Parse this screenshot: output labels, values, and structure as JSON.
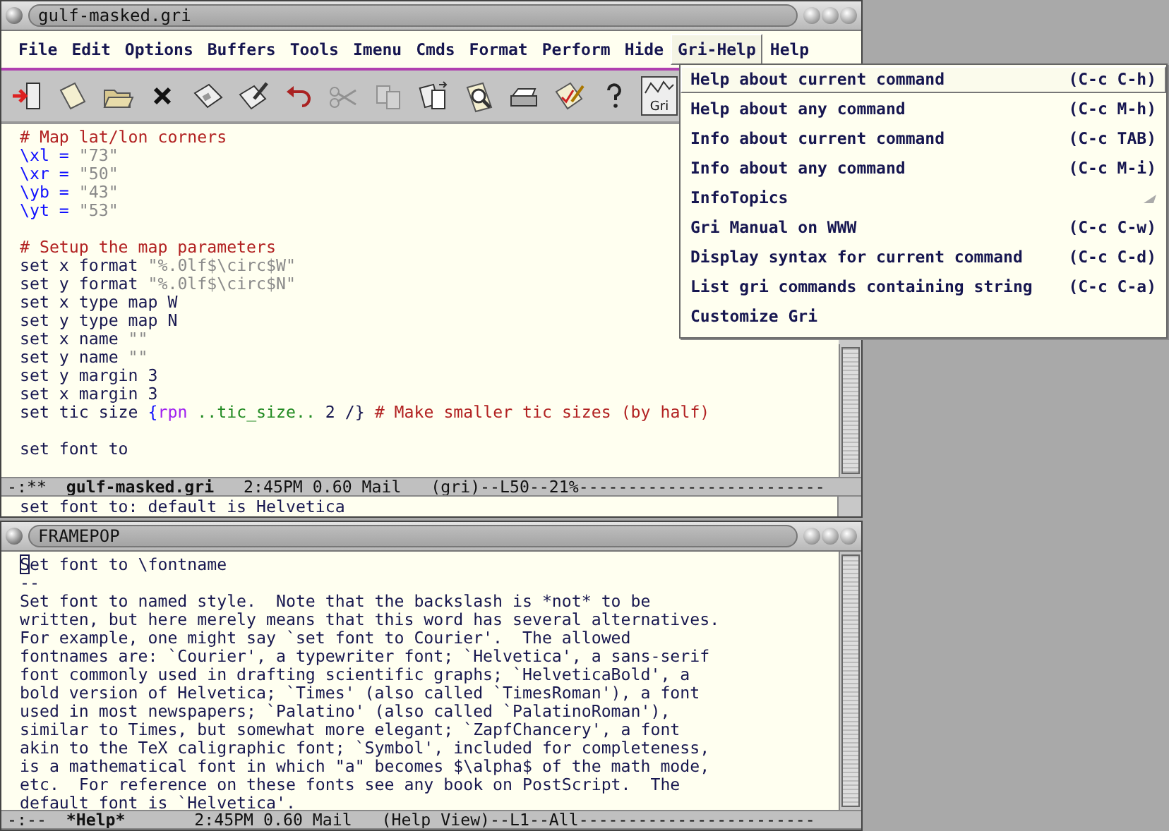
{
  "windows": [
    {
      "title": "gulf-masked.gri",
      "menubar": [
        {
          "label": "File",
          "selected": false
        },
        {
          "label": "Edit",
          "selected": false
        },
        {
          "label": "Options",
          "selected": false
        },
        {
          "label": "Buffers",
          "selected": false
        },
        {
          "label": "Tools",
          "selected": false
        },
        {
          "label": "Imenu",
          "selected": false
        },
        {
          "label": "Cmds",
          "selected": false
        },
        {
          "label": "Format",
          "selected": false
        },
        {
          "label": "Perform",
          "selected": false
        },
        {
          "label": "Hide",
          "selected": false
        },
        {
          "label": "Gri-Help",
          "selected": true
        },
        {
          "label": "Help",
          "selected": false
        }
      ],
      "toolbar": [
        {
          "kind": "exit",
          "disabled": false
        },
        {
          "kind": "new",
          "disabled": false
        },
        {
          "kind": "open",
          "disabled": false
        },
        {
          "kind": "close",
          "disabled": false
        },
        {
          "kind": "save",
          "disabled": false
        },
        {
          "kind": "saveas",
          "disabled": false
        },
        {
          "kind": "undo",
          "disabled": false
        },
        {
          "kind": "cut",
          "disabled": true
        },
        {
          "kind": "copy",
          "disabled": true
        },
        {
          "kind": "paste",
          "disabled": false
        },
        {
          "kind": "search",
          "disabled": false
        },
        {
          "kind": "print",
          "disabled": false
        },
        {
          "kind": "spell",
          "disabled": false
        },
        {
          "kind": "help",
          "disabled": false
        },
        {
          "kind": "gri",
          "label": "Gri",
          "disabled": false
        }
      ],
      "lines": [
        {
          "kind": "code",
          "segments": [
            {
              "text": "# Map lat/lon corners",
              "kind": "comment"
            }
          ]
        },
        {
          "kind": "code",
          "segments": [
            {
              "text": "\\xl = ",
              "kind": "variable"
            },
            {
              "text": "\"73\"",
              "kind": "string"
            }
          ]
        },
        {
          "kind": "code",
          "segments": [
            {
              "text": "\\xr = ",
              "kind": "variable"
            },
            {
              "text": "\"50\"",
              "kind": "string"
            }
          ]
        },
        {
          "kind": "code",
          "segments": [
            {
              "text": "\\yb = ",
              "kind": "variable"
            },
            {
              "text": "\"43\"",
              "kind": "string"
            }
          ]
        },
        {
          "kind": "code",
          "segments": [
            {
              "text": "\\yt = ",
              "kind": "variable"
            },
            {
              "text": "\"53\"",
              "kind": "string"
            }
          ]
        },
        {
          "kind": "blank"
        },
        {
          "kind": "code",
          "segments": [
            {
              "text": "# Setup the map parameters",
              "kind": "comment"
            }
          ]
        },
        {
          "kind": "code",
          "segments": [
            {
              "text": "set x format ",
              "kind": "plain"
            },
            {
              "text": "\"%.0lf$\\circ$W\"",
              "kind": "string"
            }
          ]
        },
        {
          "kind": "code",
          "segments": [
            {
              "text": "set y format ",
              "kind": "plain"
            },
            {
              "text": "\"%.0lf$\\circ$N\"",
              "kind": "string"
            }
          ]
        },
        {
          "kind": "code",
          "segments": [
            {
              "text": "set x type map W",
              "kind": "plain"
            }
          ]
        },
        {
          "kind": "code",
          "segments": [
            {
              "text": "set y type map N",
              "kind": "plain"
            }
          ]
        },
        {
          "kind": "code",
          "segments": [
            {
              "text": "set x name ",
              "kind": "plain"
            },
            {
              "text": "\"\"",
              "kind": "string"
            }
          ]
        },
        {
          "kind": "code",
          "segments": [
            {
              "text": "set y name ",
              "kind": "plain"
            },
            {
              "text": "\"\"",
              "kind": "string"
            }
          ]
        },
        {
          "kind": "code",
          "segments": [
            {
              "text": "set y margin 3",
              "kind": "plain"
            }
          ]
        },
        {
          "kind": "code",
          "segments": [
            {
              "text": "set x margin 3",
              "kind": "plain"
            }
          ]
        },
        {
          "kind": "code",
          "segments": [
            {
              "text": "set tic size ",
              "kind": "plain"
            },
            {
              "text": "{",
              "kind": "variable"
            },
            {
              "text": "rpn",
              "kind": "keyword"
            },
            {
              "text": " ..tic_size..",
              "kind": "constant"
            },
            {
              "text": " 2 /} ",
              "kind": "plain"
            },
            {
              "text": "# Make smaller tic sizes (by half)",
              "kind": "comment"
            }
          ]
        },
        {
          "kind": "blank"
        },
        {
          "kind": "code",
          "segments": [
            {
              "text": "set font to",
              "kind": "plain"
            }
          ]
        }
      ],
      "mode_line": {
        "flags": "-:**",
        "buffer": "gulf-masked.gri",
        "info": "2:45PM 0.60 Mail   (gri)--L50--21%-------------------------"
      },
      "echo": "set font to: default is Helvetica"
    },
    {
      "title": "FRAMEPOP",
      "lines": [
        {
          "kind": "code",
          "segments": [
            {
              "text": "S",
              "kind": "cursor"
            },
            {
              "text": "et font to \\fontname",
              "kind": "plain"
            }
          ]
        },
        {
          "kind": "code",
          "segments": [
            {
              "text": "--",
              "kind": "plain"
            }
          ]
        },
        {
          "kind": "code",
          "segments": [
            {
              "text": "Set font to named style.  Note that the backslash is *not* to be",
              "kind": "plain"
            }
          ]
        },
        {
          "kind": "code",
          "segments": [
            {
              "text": "written, but here merely means that this word has several alternatives.",
              "kind": "plain"
            }
          ]
        },
        {
          "kind": "code",
          "segments": [
            {
              "text": "For example, one might say `set font to Courier'.  The allowed",
              "kind": "plain"
            }
          ]
        },
        {
          "kind": "code",
          "segments": [
            {
              "text": "fontnames are: `Courier', a typewriter font; `Helvetica', a sans-serif",
              "kind": "plain"
            }
          ]
        },
        {
          "kind": "code",
          "segments": [
            {
              "text": "font commonly used in drafting scientific graphs; `HelveticaBold', a",
              "kind": "plain"
            }
          ]
        },
        {
          "kind": "code",
          "segments": [
            {
              "text": "bold version of Helvetica; `Times' (also called `TimesRoman'), a font",
              "kind": "plain"
            }
          ]
        },
        {
          "kind": "code",
          "segments": [
            {
              "text": "used in most newspapers; `Palatino' (also called `PalatinoRoman'),",
              "kind": "plain"
            }
          ]
        },
        {
          "kind": "code",
          "segments": [
            {
              "text": "similar to Times, but somewhat more elegant; `ZapfChancery', a font",
              "kind": "plain"
            }
          ]
        },
        {
          "kind": "code",
          "segments": [
            {
              "text": "akin to the TeX caligraphic font; `Symbol', included for completeness,",
              "kind": "plain"
            }
          ]
        },
        {
          "kind": "code",
          "segments": [
            {
              "text": "is a mathematical font in which \"a\" becomes $\\alpha$ of the math mode,",
              "kind": "plain"
            }
          ]
        },
        {
          "kind": "code",
          "segments": [
            {
              "text": "etc.  For reference on these fonts see any book on PostScript.  The",
              "kind": "plain"
            }
          ]
        },
        {
          "kind": "code",
          "segments": [
            {
              "text": "default font is `Helvetica'.",
              "kind": "plain"
            }
          ]
        }
      ],
      "mode_line": {
        "flags": "-:--",
        "buffer": "*Help*",
        "info": "    2:45PM 0.60 Mail   (Help View)--L1--All------------------------"
      }
    }
  ],
  "dropdown": {
    "items": [
      {
        "label": "Help about current command",
        "shortcut": "(C-c C-h)",
        "kind": "command",
        "selected": true
      },
      {
        "label": "Help about any command",
        "shortcut": "(C-c M-h)",
        "kind": "command",
        "selected": false
      },
      {
        "label": "Info about current command",
        "shortcut": "(C-c TAB)",
        "kind": "command",
        "selected": false
      },
      {
        "label": "Info about any command",
        "shortcut": "(C-c M-i)",
        "kind": "command",
        "selected": false
      },
      {
        "label": "InfoTopics",
        "kind": "submenu",
        "selected": false
      },
      {
        "label": "Gri Manual on WWW",
        "shortcut": "(C-c C-w)",
        "kind": "command",
        "selected": false
      },
      {
        "label": "Display syntax for current command",
        "shortcut": "(C-c C-d)",
        "kind": "command",
        "selected": false
      },
      {
        "label": "List gri commands containing string",
        "shortcut": "(C-c C-a)",
        "kind": "command",
        "selected": false
      },
      {
        "label": "Customize Gri",
        "kind": "command",
        "selected": false
      }
    ]
  }
}
